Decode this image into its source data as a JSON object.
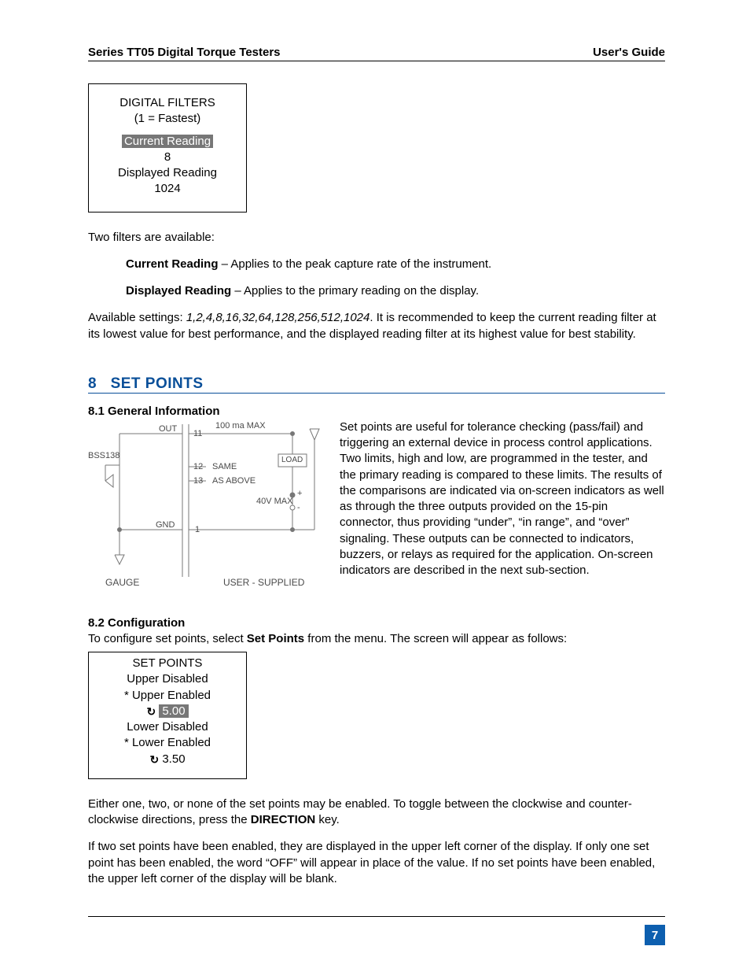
{
  "header": {
    "left": "Series TT05 Digital Torque Testers",
    "right": "User's Guide"
  },
  "digital_filters_box": {
    "title": "DIGITAL FILTERS",
    "subtitle": "(1 = Fastest)",
    "current_label": "Current Reading",
    "current_value": "8",
    "displayed_label": "Displayed Reading",
    "displayed_value": "1024"
  },
  "filters_intro": "Two filters are available:",
  "filter_current_label": "Current Reading",
  "filter_current_text": " – Applies to the peak capture rate of the instrument.",
  "filter_displayed_label": "Displayed Reading",
  "filter_displayed_text": " – Applies to the primary reading on the display.",
  "avail_prefix": "Available settings: ",
  "avail_values": "1,2,4,8,16,32,64,128,256,512,1024",
  "avail_suffix": ". It is recommended to keep the current reading filter at its lowest value for best performance, and the displayed reading filter at its highest value for best stability.",
  "section8": {
    "num": "8",
    "title": "SET POINTS"
  },
  "sub81": "8.1 General Information",
  "diagram": {
    "bss": "BSS138",
    "out": "OUT",
    "gnd": "GND",
    "p11": "11",
    "p12": "12",
    "p13": "13",
    "p1": "1",
    "max": "100 ma MAX",
    "load": "LOAD",
    "same": "SAME",
    "asabove": "AS ABOVE",
    "vmax": "40V MAX",
    "plus": "+",
    "minus": "-",
    "gauge": "GAUGE",
    "user": "USER - SUPPLIED"
  },
  "setpoints_para": "Set points are useful for tolerance checking (pass/fail) and triggering an external device in process control applications. Two limits, high and low, are programmed in the tester, and the primary reading is compared to these limits. The results of the comparisons are indicated via on-screen indicators as well as through the three outputs provided on the 15-pin connector, thus providing “under”, “in range”, and “over” signaling. These outputs can be connected to indicators, buzzers, or relays as required for the application. On-screen indicators are described in the next sub-section.",
  "sub82": "8.2 Configuration",
  "config_line_a": "To configure set points, select ",
  "config_line_b": "Set Points",
  "config_line_c": " from the menu. The screen will appear as follows:",
  "setpoints_box": {
    "title": "SET POINTS",
    "l1": "Upper Disabled",
    "l2": "* Upper Enabled",
    "v2": "5.00",
    "l3": "Lower Disabled",
    "l4": "* Lower Enabled",
    "v4": "3.50"
  },
  "either_a": "Either one, two, or none of the set points may be enabled. To toggle between the clockwise and counter-clockwise directions, press the ",
  "either_b": "DIRECTION",
  "either_c": " key.",
  "iftwo": "If two set points have been enabled, they are displayed in the upper left corner of the display. If only one set point has been enabled, the word “OFF” will appear in place of the value. If no set points have been enabled, the upper left corner of the display will be blank.",
  "page_number": "7"
}
